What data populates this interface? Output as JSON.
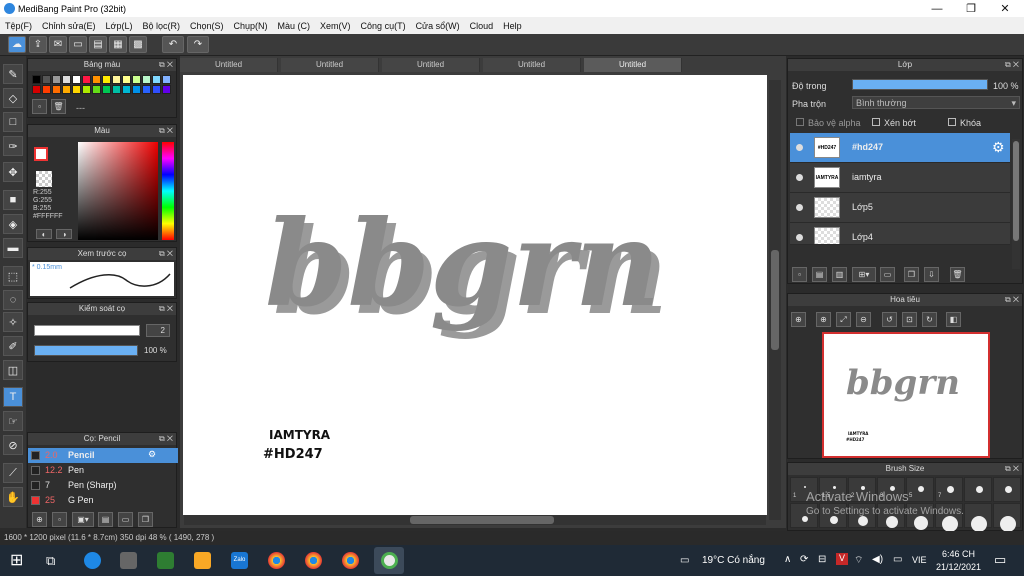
{
  "window": {
    "title": "MediBang Paint Pro (32bit)",
    "minimize": "—",
    "maximize": "❐",
    "close": "✕"
  },
  "menu": [
    "Tệp(F)",
    "Chỉnh sửa(E)",
    "Lớp(L)",
    "Bộ lọc(R)",
    "Chọn(S)",
    "Chụp(N)",
    "Màu (C)",
    "Xem(V)",
    "Công cụ(T)",
    "Cửa sổ(W)",
    "Cloud",
    "Help"
  ],
  "panels": {
    "palette": {
      "title": "Bảng màu",
      "bottom_text": "---"
    },
    "color": {
      "title": "Màu",
      "r": "R:255",
      "g": "G:255",
      "b": "B:255",
      "hex": "#FFFFFF"
    },
    "brush_preview": {
      "title": "Xem trước cọ",
      "size": "* 0.15mm"
    },
    "brush_control": {
      "title": "Kiểm soát cọ",
      "size_value": "2",
      "opacity": "100 %",
      "opacity_fraction": 1.0
    },
    "brush": {
      "title": "Cọ: Pencil",
      "items": [
        {
          "size": "2.0",
          "name": "Pencil"
        },
        {
          "size": "12.2",
          "name": "Pen"
        },
        {
          "size": "7",
          "name": "Pen (Sharp)"
        },
        {
          "size": "25",
          "name": "G Pen"
        }
      ]
    }
  },
  "tabs": [
    "Untitled",
    "Untitled",
    "Untitled",
    "Untitled",
    "Untitled"
  ],
  "canvas": {
    "main_text": "bbgrn",
    "small_text_1": "IAMTYRA",
    "small_text_2": "#HD247"
  },
  "layers": {
    "title": "Lớp",
    "opacity_label": "Độ trong",
    "opacity_value": "100 %",
    "blend_label": "Pha trộn",
    "blend_value": "Bình thường",
    "protect_alpha": "Bảo vệ alpha",
    "clip": "Xén bớt",
    "lock": "Khóa",
    "items": [
      {
        "thumb": "#HD247",
        "name": "#hd247"
      },
      {
        "thumb": "IAMTYRA",
        "name": "iamtyra"
      },
      {
        "thumb": "",
        "name": "Lớp5"
      },
      {
        "thumb": "",
        "name": "Lớp4"
      }
    ]
  },
  "navigator": {
    "title": "Hoa tiêu",
    "preview_text": "bbgrn",
    "preview_small_1": "IAMTYRA",
    "preview_small_2": "#HD247"
  },
  "brush_size": {
    "title": "Brush Size",
    "labels": [
      "1",
      "1.5",
      "2",
      "3",
      "5",
      "7"
    ]
  },
  "watermark": {
    "line1": "Activate Windows",
    "line2": "Go to Settings to activate Windows."
  },
  "status": {
    "text": "1600 * 1200 pixel   (11.6 * 8.7cm)   350 dpi   48 %   ( 1490, 278 )"
  },
  "taskbar": {
    "weather": "19°C  Có nắng",
    "lang": "VIE",
    "time": "6:46 CH",
    "date": "21/12/2021"
  },
  "colors": {
    "accent": "#4a90d9",
    "navigator_border": "#d32f2f",
    "text_gray": "#8a8a8a"
  }
}
